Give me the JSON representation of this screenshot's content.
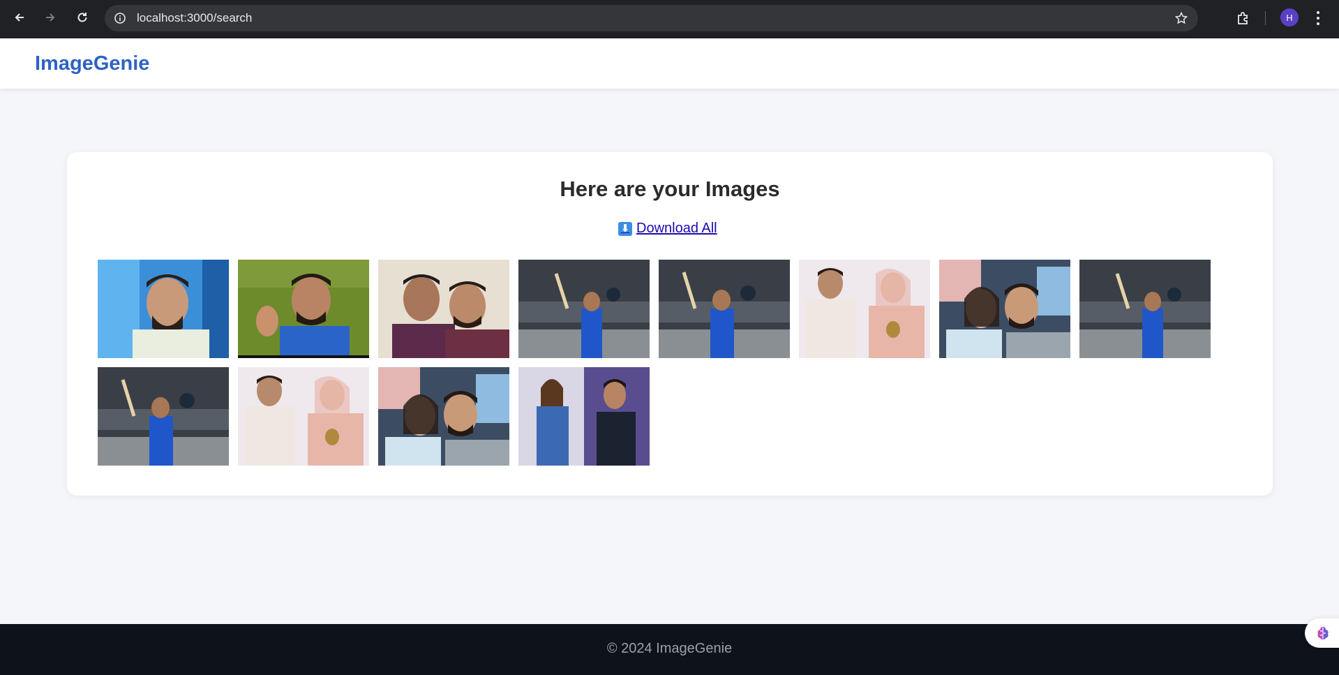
{
  "browser": {
    "url": "localhost:3000/search",
    "profile_initial": "H"
  },
  "app": {
    "logo": "ImageGenie"
  },
  "results": {
    "title": "Here are your Images",
    "download_all": "Download All",
    "images": [
      {
        "subject": "portrait-smiling-blue-background"
      },
      {
        "subject": "portrait-waving-green-background"
      },
      {
        "subject": "two-men-selfie"
      },
      {
        "subject": "cricketer-raising-bat-stadium"
      },
      {
        "subject": "cricketer-raising-bat-stadium"
      },
      {
        "subject": "couple-wedding-attire"
      },
      {
        "subject": "couple-selfie-pillows"
      },
      {
        "subject": "cricketer-raising-bat-stadium"
      },
      {
        "subject": "cricketer-raising-bat-stadium"
      },
      {
        "subject": "couple-wedding-attire"
      },
      {
        "subject": "couple-selfie-pillows"
      },
      {
        "subject": "woman-blue-dress-and-man-dark-jacket"
      }
    ]
  },
  "footer": {
    "copyright": "© 2024 ImageGenie"
  },
  "colors": {
    "logo": "#2e63c4",
    "footer_bg": "#0e121b",
    "page_bg": "#f4f6fa"
  }
}
